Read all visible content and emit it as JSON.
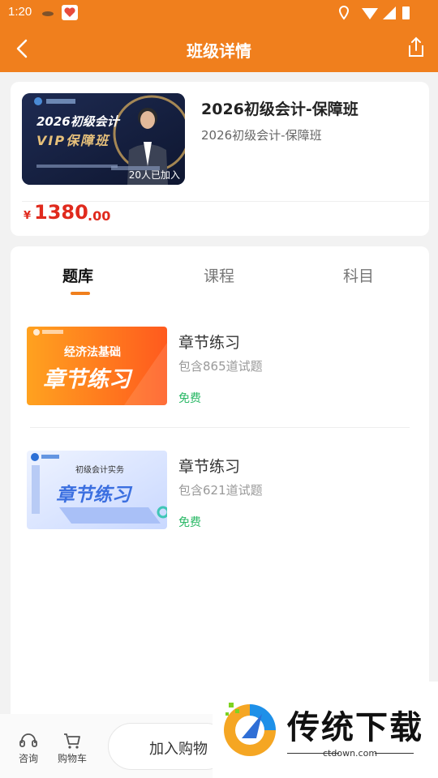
{
  "status_bar": {
    "time": "1:20"
  },
  "header": {
    "title": "班级详情",
    "back_icon": "arrow-left-icon",
    "share_icon": "share-icon"
  },
  "course": {
    "title": "2026初级会计-保障班",
    "subtitle": "2026初级会计-保障班",
    "joined": "20人已加入",
    "price": {
      "currency": "¥",
      "integer": "1380",
      "decimal": ".00"
    },
    "thumb": {
      "line1": "2026初级会计",
      "line2": "VIP保障班"
    }
  },
  "tabs": [
    {
      "label": "题库",
      "active": true
    },
    {
      "label": "课程",
      "active": false
    },
    {
      "label": "科目",
      "active": false
    }
  ],
  "items": [
    {
      "name": "章节练习",
      "count": "包含865道试题",
      "tag": "免费",
      "banner_top": "经济法基础",
      "banner_main": "章节练习"
    },
    {
      "name": "章节练习",
      "count": "包含621道试题",
      "tag": "免费",
      "banner_top": "初级会计实务",
      "banner_main": "章节练习"
    }
  ],
  "bottom_bar": {
    "consult": "咨询",
    "cart": "购物车",
    "add_to_cart": "加入购物"
  },
  "watermark": {
    "text": "传统下载",
    "url": "ctdown.com"
  },
  "colors": {
    "accent": "#f07f1d",
    "price": "#e02a1d",
    "free": "#2ab866"
  }
}
